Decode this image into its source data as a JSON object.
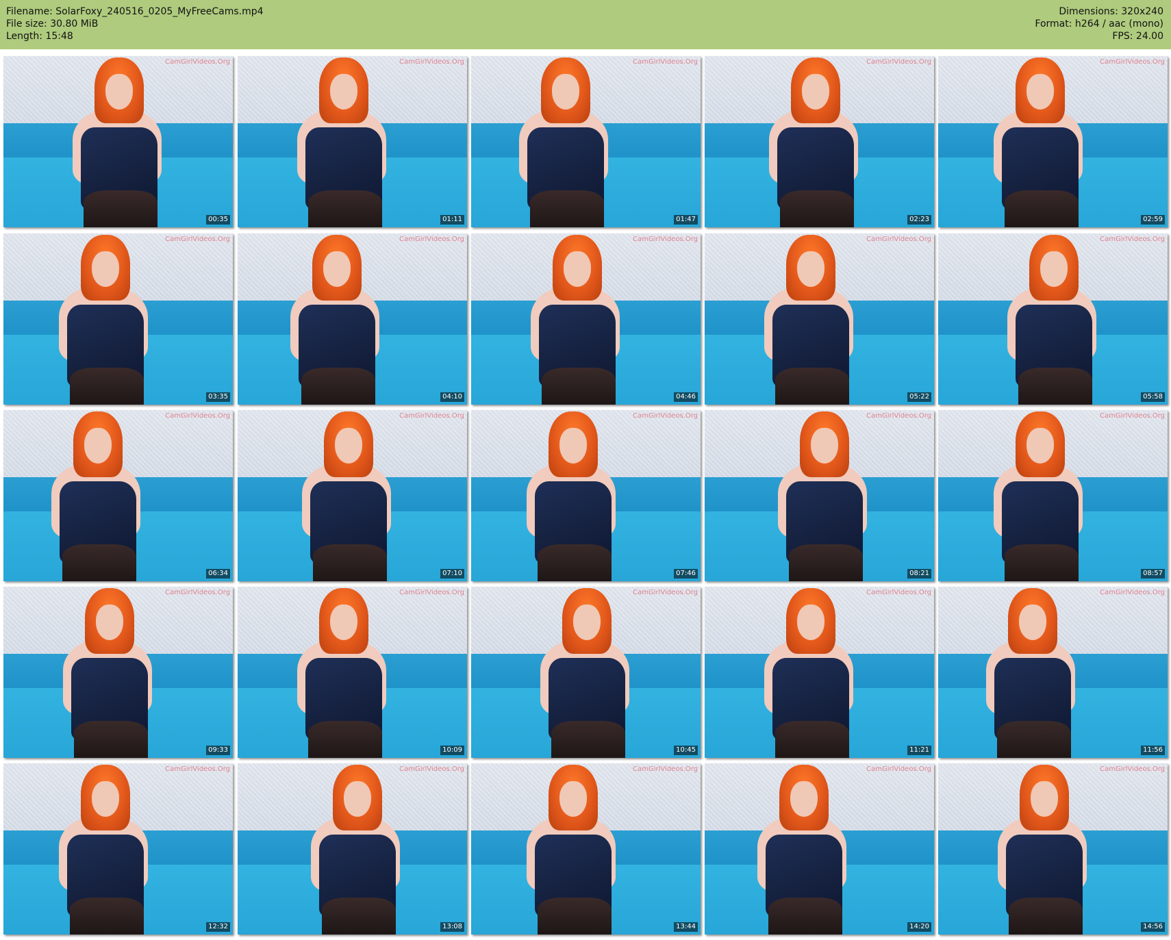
{
  "header": {
    "filename": "Filename: SolarFoxy_240516_0205_MyFreeCams.mp4",
    "file_size": "File size: 30.80 MiB",
    "length": "Length: 15:48",
    "dimensions": "Dimensions: 320x240",
    "format": "Format: h264 / aac (mono)",
    "fps": "FPS: 24.00",
    "background_color": "#afcb7e"
  },
  "thumbnails": {
    "watermark": "CamGirlVideos.Org",
    "timestamps": [
      "00:35",
      "01:11",
      "01:47",
      "02:23",
      "02:59",
      "03:35",
      "04:10",
      "04:46",
      "05:22",
      "05:58",
      "06:34",
      "07:10",
      "07:46",
      "08:21",
      "08:57",
      "09:33",
      "10:09",
      "10:45",
      "11:21",
      "11:56",
      "12:32",
      "13:08",
      "13:44",
      "14:20",
      "14:56"
    ]
  }
}
